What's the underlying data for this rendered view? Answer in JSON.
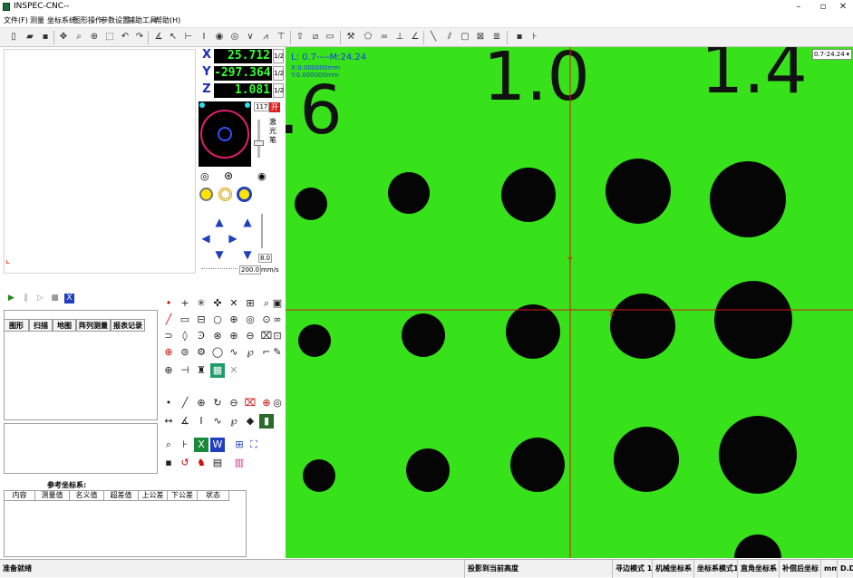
{
  "title": "INSPEC-CNC--",
  "window_buttons": {
    "minimize": "–",
    "maximize": "▫",
    "close": "✕"
  },
  "menu": [
    "文件(F)",
    "测量",
    "坐标系统",
    "图形操作",
    "参数设置",
    "辅助工具",
    "帮助(H)"
  ],
  "dro": {
    "x_label": "X",
    "x_value": "25.712",
    "x_ratio": "1/2",
    "y_label": "Y",
    "y_value": "-297.364",
    "y_ratio": "1/2",
    "z_label": "Z",
    "z_value": "1.081",
    "z_ratio": "1/2"
  },
  "light": {
    "level": "117",
    "toggle": "开",
    "label": "激光笔"
  },
  "control": {
    "speed_value": "8.0",
    "feed_value": "200.0",
    "feed_unit": "mm/s"
  },
  "tabs": [
    "图形",
    "扫描",
    "地图",
    "阵列测量",
    "报表记录"
  ],
  "reference_title": "参考坐标系:",
  "result_columns": [
    "内容",
    "测量值",
    "名义值",
    "超差值",
    "上公差",
    "下公差",
    "状态"
  ],
  "viewport": {
    "info_line1": "L: 0.7----M:24.24",
    "info_line2": "X:0.000000mm",
    "info_line3": "Y:0.000000mm",
    "zoom_option": "0.7-24.24",
    "plate_labels": [
      ".6",
      "1.0",
      "1.4"
    ],
    "crosshair_y_label": "Y",
    "crosshair_x_label": "X",
    "background_color": "#38e21a",
    "crosshair_color": "#d81818"
  },
  "status": {
    "ready": "准备就绪",
    "projection": "投影到当前高度",
    "edge_mode": "寻边模式 1",
    "machine_coord": "机械坐标系",
    "coord_mode": "坐标系模式1",
    "rect_coord": "直角坐标系",
    "compensated": "补偿后坐标",
    "unit": "mm",
    "angle_format": "D.D"
  }
}
